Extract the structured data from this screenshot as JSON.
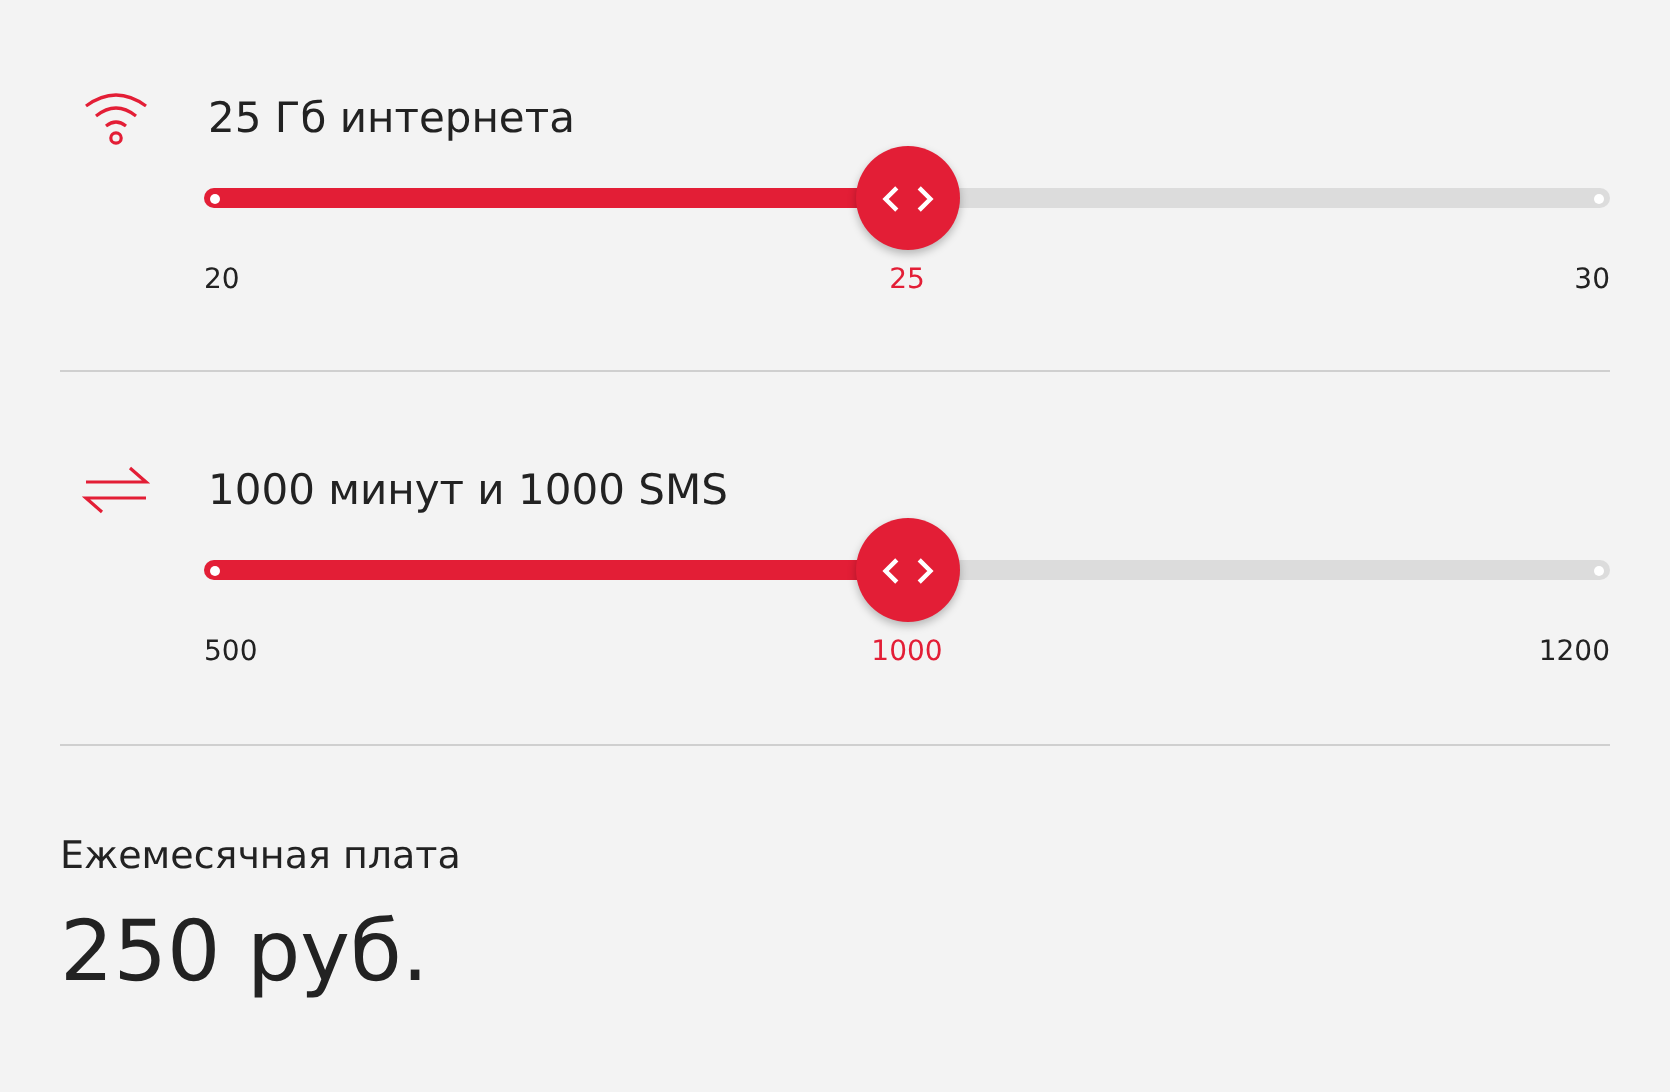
{
  "sliders": [
    {
      "kind": "wifi",
      "title": "25 Гб интернета",
      "level": 0.5,
      "min_label": "20",
      "value_label": "25",
      "max_label": "30"
    },
    {
      "kind": "exchange",
      "title": "1000 минут и 1000 SMS",
      "level": 0.5,
      "min_label": "500",
      "value_label": "1000",
      "max_label": "1200"
    }
  ],
  "monthly_fee": {
    "label": "Ежемесячная плата",
    "amount": "250 руб."
  }
}
